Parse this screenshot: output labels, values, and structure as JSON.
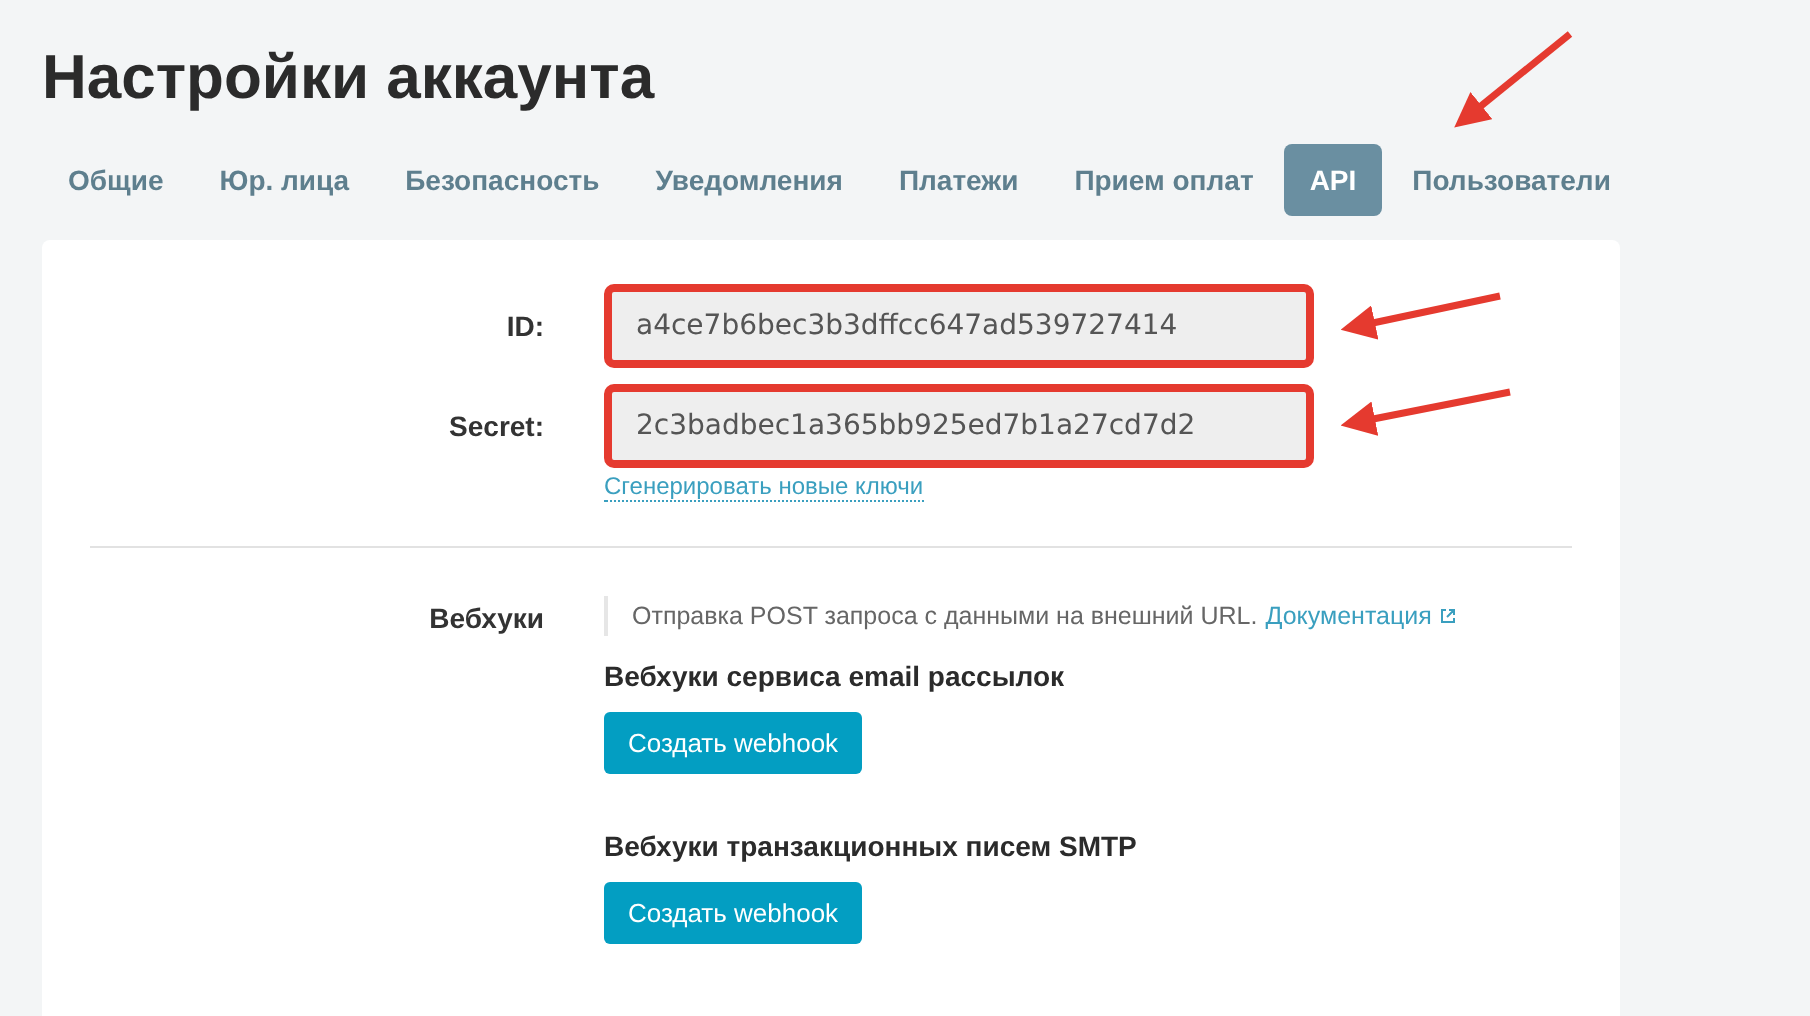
{
  "title": "Настройки аккаунта",
  "tabs": [
    {
      "label": "Общие",
      "selected": false
    },
    {
      "label": "Юр. лица",
      "selected": false
    },
    {
      "label": "Безопасность",
      "selected": false
    },
    {
      "label": "Уведомления",
      "selected": false
    },
    {
      "label": "Платежи",
      "selected": false
    },
    {
      "label": "Прием оплат",
      "selected": false
    },
    {
      "label": "API",
      "selected": true
    },
    {
      "label": "Пользователи",
      "selected": false
    }
  ],
  "keys": [
    {
      "label": "ID:",
      "value": "a4ce7b6bec3b3dffcc647ad539727414",
      "highlighted": true
    },
    {
      "label": "Secret:",
      "value": "2c3badbec1a365bb925ed7b1a27cd7d2",
      "highlighted": true
    }
  ],
  "regenerate_link": "Сгенерировать новые ключи",
  "webhooks": {
    "label": "Вебхуки",
    "description": "Отправка POST запроса с данными на внешний URL.",
    "doc_link": "Документация",
    "sections": [
      {
        "heading": "Вебхуки сервиса email рассылок",
        "button": "Создать webhook"
      },
      {
        "heading": "Вебхуки транзакционных писем SMTP",
        "button": "Создать webhook"
      }
    ]
  }
}
